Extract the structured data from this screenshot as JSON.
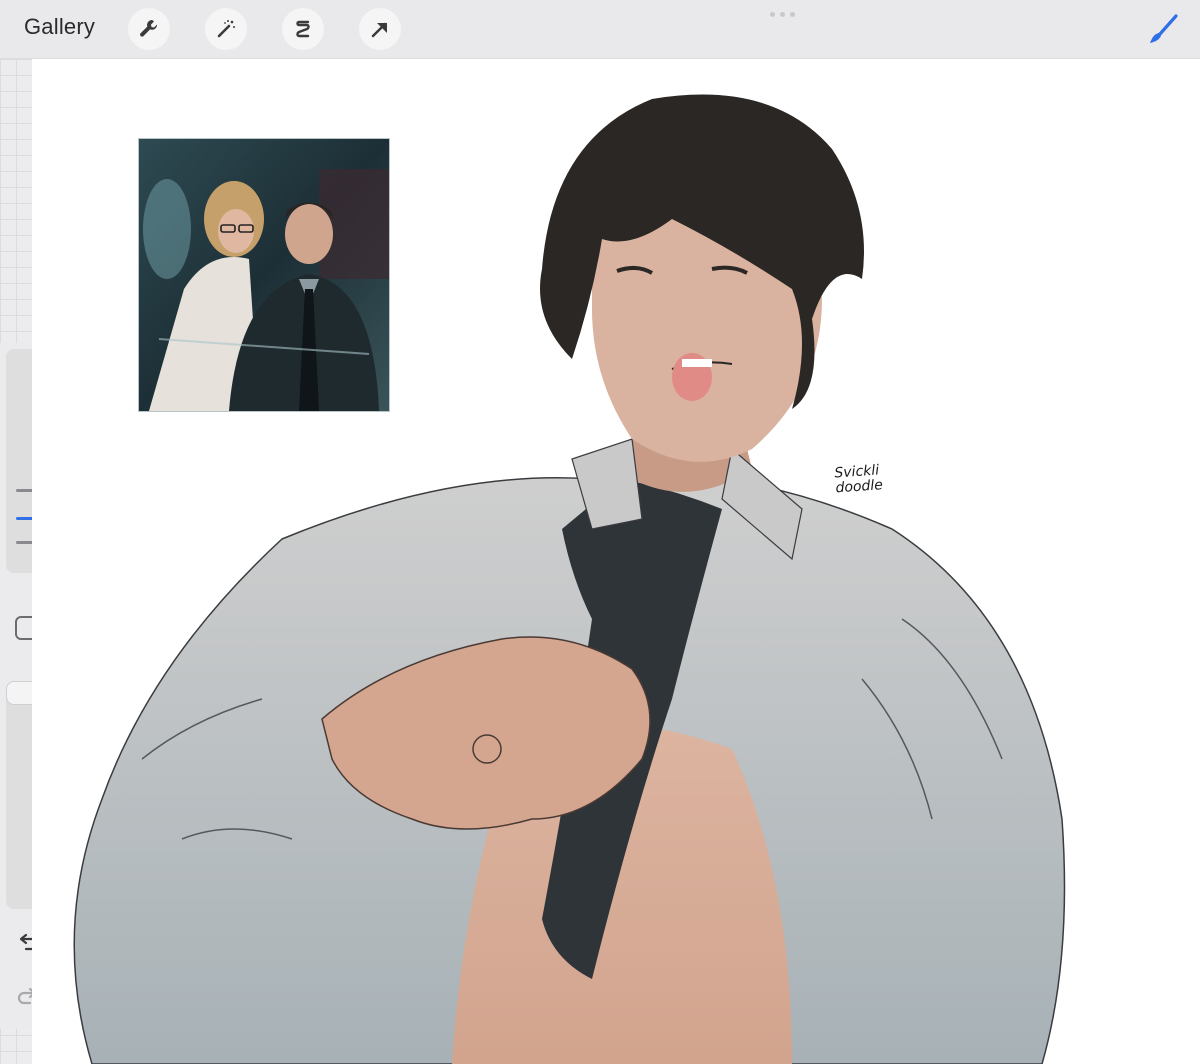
{
  "toolbar": {
    "gallery_label": "Gallery",
    "tools": [
      "wrench-icon",
      "magic-wand-icon",
      "selection-s-icon",
      "transform-arrow-icon"
    ],
    "active_tool": "brush-icon",
    "accent_color": "#2f6fe8"
  },
  "sidebar": {
    "brush_size_slider": "tick-marks",
    "opacity_slider": "thumb",
    "modifier_button": "square",
    "undo": "undo-icon",
    "redo": "redo-icon"
  },
  "canvas": {
    "signature_line1": "Svickli",
    "signature_line2": "doodle"
  }
}
